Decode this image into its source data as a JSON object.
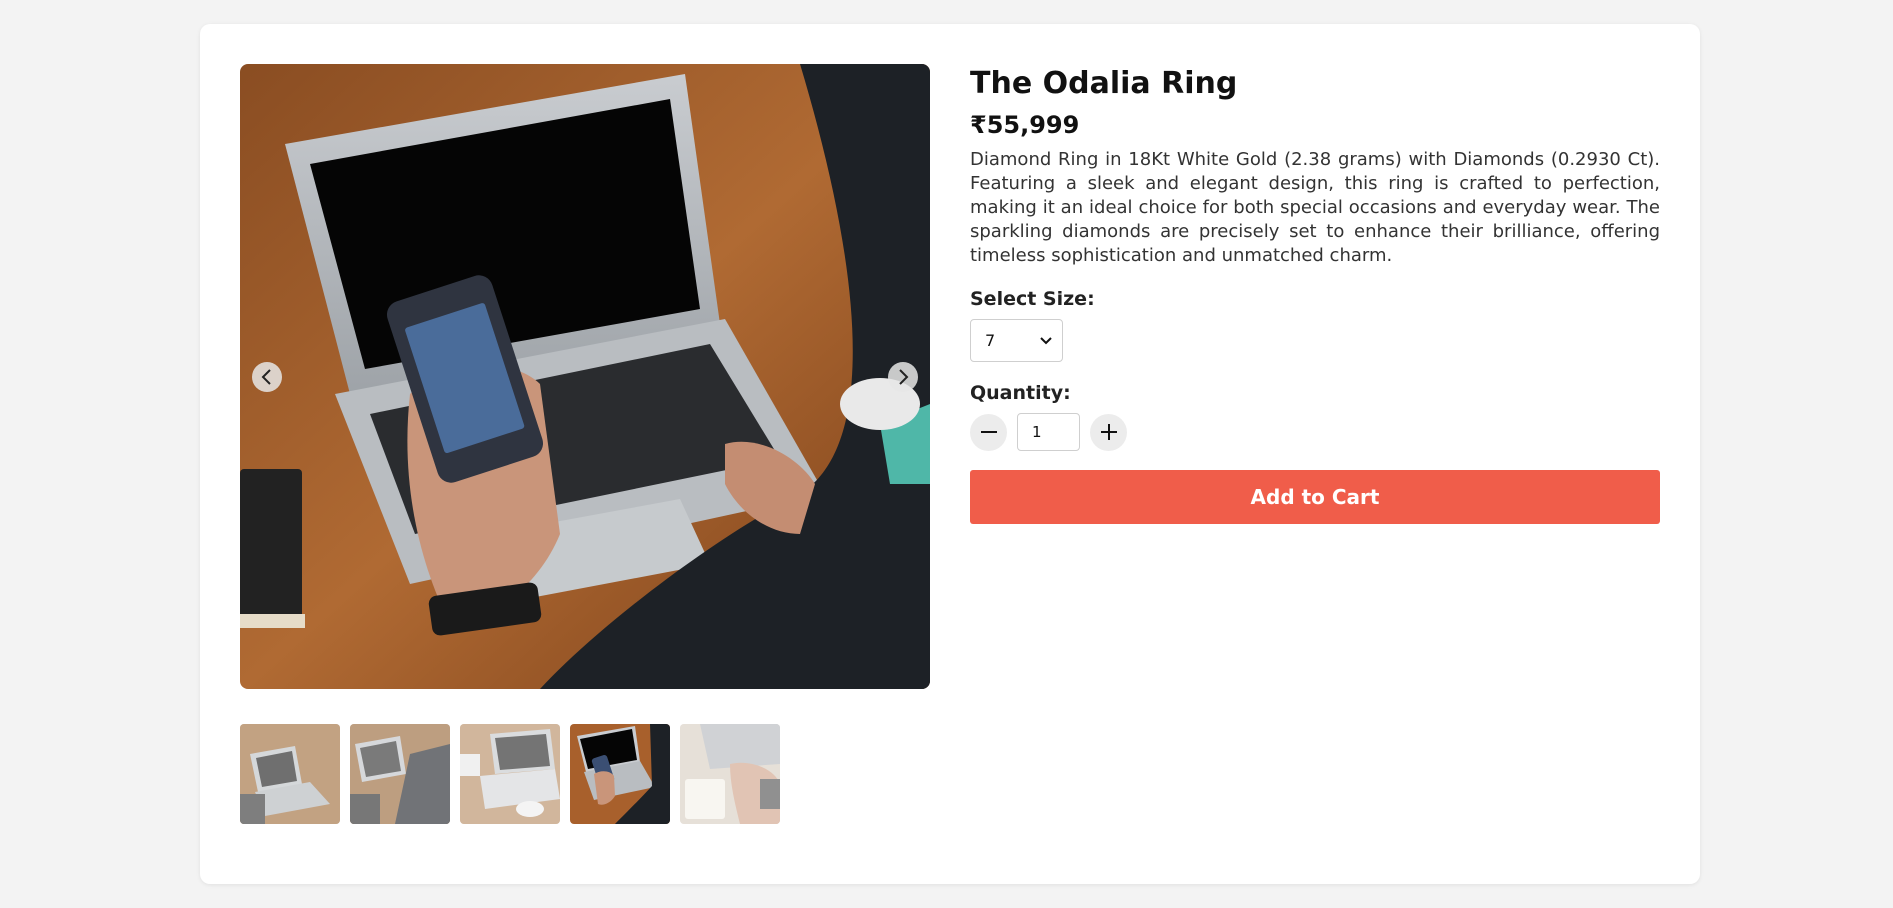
{
  "product": {
    "title": "The Odalia Ring",
    "price": "₹55,999",
    "description": "Diamond Ring in 18Kt White Gold (2.38 grams) with Diamonds (0.2930 Ct). Featuring a sleek and elegant design, this ring is crafted to perfection, making it an ideal choice for both special occasions and everyday wear. The sparkling diamonds are precisely set to enhance their brilliance, offering timeless sophistication and unmatched charm."
  },
  "size": {
    "label": "Select Size:",
    "selected": "7"
  },
  "quantity": {
    "label": "Quantity:",
    "value": "1"
  },
  "cart": {
    "button_label": "Add to Cart"
  },
  "gallery": {
    "active_index": 3,
    "thumbnail_count": 5,
    "icons": {
      "prev": "chevron-left-icon",
      "next": "chevron-right-icon",
      "minus": "minus-icon",
      "plus": "plus-icon",
      "dropdown": "chevron-down-icon"
    }
  },
  "colors": {
    "accent": "#f05d4a",
    "page_background": "#f3f3f3"
  }
}
